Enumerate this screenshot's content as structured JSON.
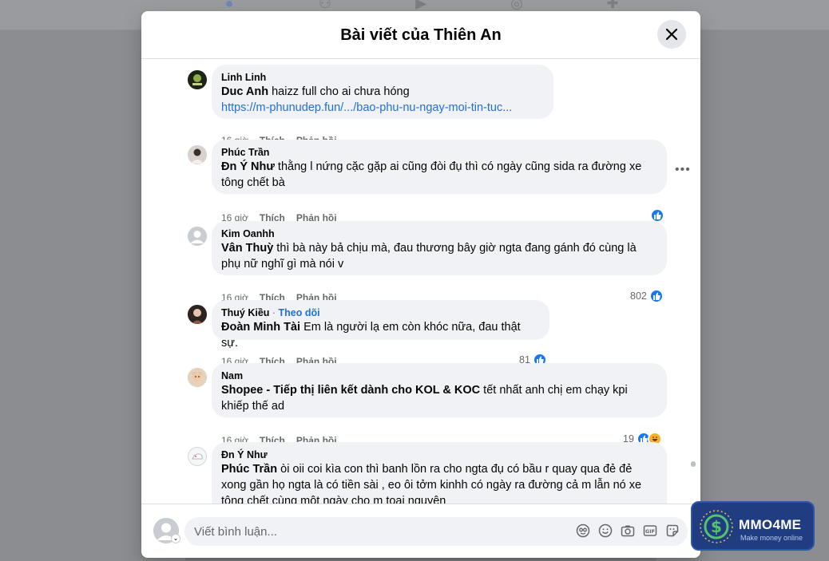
{
  "dialog": {
    "title": "Bài viết của Thiên An"
  },
  "comments": [
    {
      "author": "Linh Linh",
      "mention": "Duc Anh",
      "text": " haizz full cho ai chưa hóng",
      "link": "https://m-phunudep.fun/.../bao-phu-nu-ngay-moi-tin-tuc...",
      "time": "16 giờ",
      "like_label": "Thích",
      "reply_label": "Phản hồi"
    },
    {
      "author": "Phúc Trần",
      "mention": "Đn Ý Như",
      "text": " thằng l nứng cặc gặp ai cũng đòi đụ thì có ngày cũng sida ra đường xe tông chết bà",
      "time": "16 giờ",
      "like_label": "Thích",
      "reply_label": "Phản hồi",
      "reactions": [
        "like"
      ]
    },
    {
      "author": "Kim Oanhh",
      "mention": "Vân Thuỳ",
      "text": " thì bà này bả chịu mà, đau thương bây giờ ngta đang gánh đó cùng là phụ nữ nghĩ gì mà nói v",
      "time": "16 giờ",
      "like_label": "Thích",
      "reply_label": "Phản hồi",
      "reaction_count": "802",
      "reactions": [
        "like"
      ]
    },
    {
      "author": "Thuý Kiều",
      "follow_sep": " · ",
      "follow_label": "Theo dõi",
      "mention": "Đoàn Minh Tài",
      "text": " Em là người lạ em còn khóc nữa, đau thật sự.",
      "time": "16 giờ",
      "like_label": "Thích",
      "reply_label": "Phản hồi",
      "reaction_count": "81",
      "reactions": [
        "like"
      ]
    },
    {
      "author": "Nam",
      "mention": "Shopee - Tiếp thị liên kết dành cho KOL & KOC",
      "text": " tết nhất anh chị em chạy kpi khiếp thế ad",
      "time": "16 giờ",
      "like_label": "Thích",
      "reply_label": "Phản hồi",
      "reaction_count": "19",
      "reactions": [
        "like",
        "haha"
      ]
    },
    {
      "author": "Đn Ý Như",
      "mention": "Phúc Trần",
      "text": " òi oii coi kìa con thì banh lồn ra cho ngta đụ có bầu r quay qua đẻ đẻ xong gần họ ngta là có tiền sài , eo ôi tởm kinhh có ngày ra đường cả m lẫn nó xe tông chết cùng một ngày cho m toại nguyện"
    }
  ],
  "composer": {
    "placeholder": "Viết bình luận..."
  },
  "watermark": {
    "name": "MMO4ME",
    "tagline": "Make money online"
  },
  "icons": {
    "close": "close-icon",
    "more": "more-options-icon",
    "like": "like-reaction-icon",
    "haha": "haha-reaction-icon",
    "composer": [
      "avatar-icon",
      "emoji-icon",
      "camera-icon",
      "gif-icon",
      "sticker-icon"
    ]
  },
  "colors": {
    "accent": "#1877f2",
    "link": "#216fdb",
    "bubble": "#f0f2f5",
    "secondary_text": "#65676b"
  }
}
